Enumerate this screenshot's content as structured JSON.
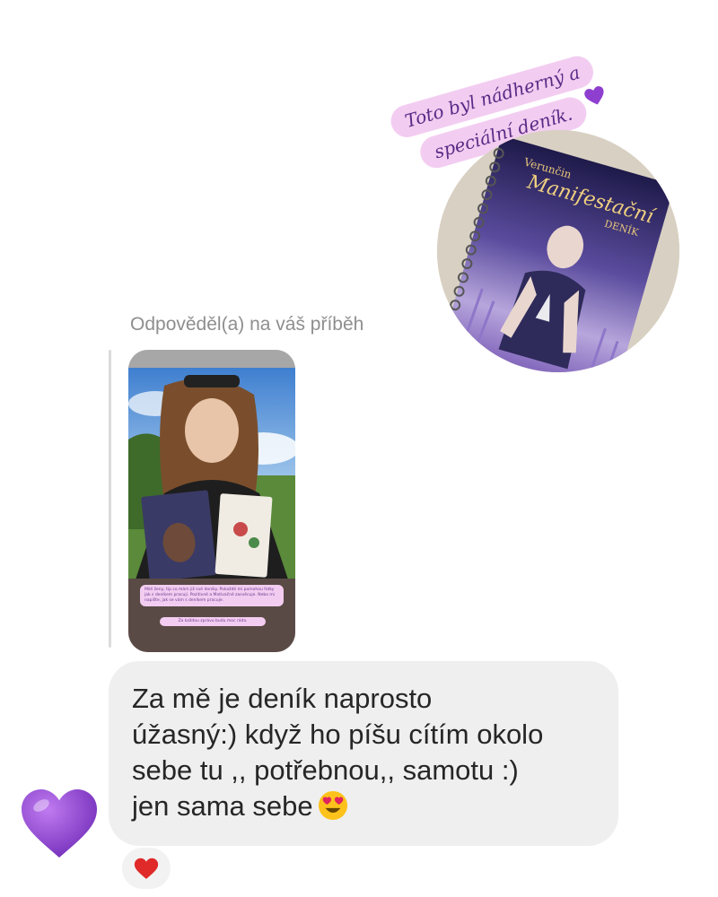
{
  "story_sticker": {
    "line1": "Toto byl nádherný a",
    "line2": "speciální deník."
  },
  "story_book": {
    "brand": "Verunčin",
    "title": "Manifestační",
    "subtitle": "DENÍK"
  },
  "reply_label": "Odpověděl(a) na váš příběh",
  "replied_story": {
    "caption_line": "Milé ženy, tip co mám již své deníky. Pokaždé mi pomohou fotky jak s deníkem pracuji. Pozitivně a Motivačně zasvěcuje. Nebo mi napište, jak se vám s deníkem pracuje.",
    "caption_line2": "Za každou zprávu budu moc ráda."
  },
  "message": {
    "text": "Za mě je deník naprosto\núžasný:) když ho píšu cítím okolo\nsebe tu ,, potřebnou,, samotu :)\njen sama sebe",
    "emoji": "heart-eyes-emoji"
  },
  "reaction": {
    "emoji": "red-heart"
  },
  "colors": {
    "sticker_bg": "#f3cdf1",
    "sticker_text": "#5b2a86",
    "bubble_bg": "#efefef",
    "heart_purple": "#8e3fcf",
    "reaction_red": "#e02929"
  }
}
